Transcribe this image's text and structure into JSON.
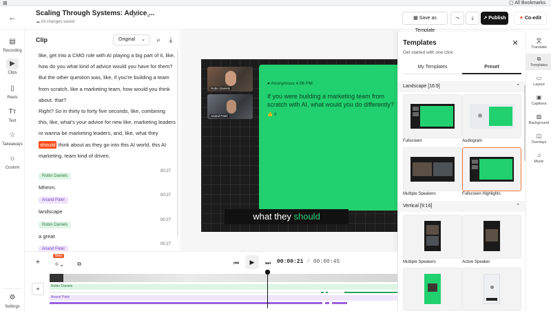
{
  "browser": {
    "bookmarks_label": "All Bookmarks"
  },
  "header": {
    "title": "Scaling Through Systems: Advice ...",
    "save_status": "All changes saved",
    "save_template_label": "Save as Template",
    "publish_label": "Publish",
    "coedit_label": "Co-edit"
  },
  "left_nav": {
    "items": [
      {
        "label": "Recording",
        "icon": "recording-icon"
      },
      {
        "label": "Clips",
        "icon": "play-icon"
      },
      {
        "label": "Reels",
        "icon": "reels-icon"
      },
      {
        "label": "Text",
        "icon": "text-icon"
      },
      {
        "label": "Takeaways",
        "icon": "star-icon"
      },
      {
        "label": "Custom",
        "icon": "bulb-icon"
      }
    ],
    "settings_label": "Settings"
  },
  "clip": {
    "title": "Clip",
    "version_select": "Original",
    "paragraph1": "like, get into a CMO role with AI playing a big part of it, like, how do you what kind of advice would you have for them?",
    "paragraph2": "But the other question was, like, if you're building a team from scratch, like a marketing team, how would you think about. that?",
    "paragraph3_pre": "Right? So in thirty to forty five seconds, like, combining this, like, what's your advice for new like, marketing leaders or wanna be marketing leaders, and, like, what they",
    "paragraph3_highlight": "should",
    "paragraph3_post": "think about as they go into this AI world, this AI marketing. team kind of driven,",
    "segments": [
      {
        "speaker": "Robin Daniels",
        "time": "00:27",
        "text": "Mhmm.",
        "color": "green"
      },
      {
        "speaker": "Anand Patel",
        "time": "00:27",
        "text": "landscape",
        "color": "purple"
      },
      {
        "speaker": "Robin Daniels",
        "time": "00:27",
        "text": "a great",
        "color": "green"
      },
      {
        "speaker": "Anand Patel",
        "time": "00:27",
        "text": "",
        "color": "purple"
      }
    ]
  },
  "stage": {
    "speakers": [
      "Robin Daniels",
      "Anand Patel"
    ],
    "post_author": "Anonymous 4:06 PM",
    "post_text": "If you were building a marketing team from scratch with AI, what would you do differently?",
    "post_likes": "0",
    "caption_pre": "what they",
    "caption_highlight": "should"
  },
  "templates": {
    "title": "Templates",
    "subtitle": "Get started with one click",
    "tabs": [
      "My Templates",
      "Preset"
    ],
    "section_landscape": "Landscape [16:9]",
    "section_vertical": "Vertical [9:16]",
    "landscape_cards": [
      "Fullscreen",
      "Audiogram",
      "Multiple Speakers",
      "Fullscreen Highlights"
    ],
    "vertical_cards": [
      "Multiple Speakers",
      "Active Speaker"
    ]
  },
  "right_nav": {
    "items": [
      "Translate",
      "Templates",
      "Layout",
      "Captions",
      "Background",
      "Overlays",
      "Music"
    ]
  },
  "timeline": {
    "beta_label": "Beta",
    "current_time": "00:00:21",
    "separator": "/",
    "total_time": "00:00:45",
    "tracks": [
      "Robin Daniels",
      "Anand Patel"
    ]
  },
  "colors": {
    "accent_green": "#21d16f",
    "highlight_orange": "#ff4d1a",
    "selected_border": "#f27a3a"
  }
}
